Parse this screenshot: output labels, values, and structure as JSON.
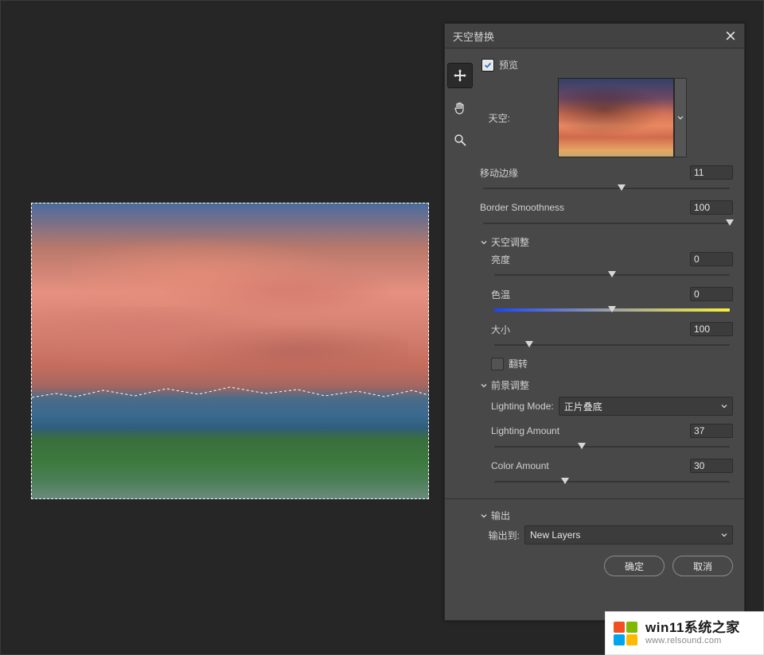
{
  "panel_title": "天空替换",
  "preview": {
    "label": "预览",
    "checked": true
  },
  "sky": {
    "label": "天空:"
  },
  "shift_edge": {
    "label": "移动边缘",
    "value": "11",
    "slider_pct": 56
  },
  "border_smoothness": {
    "label": "Border Smoothness",
    "value": "100",
    "slider_pct": 100
  },
  "sky_adjust_section": "天空调整",
  "brightness": {
    "label": "亮度",
    "value": "0",
    "slider_pct": 50
  },
  "temperature": {
    "label": "色温",
    "value": "0",
    "slider_pct": 50
  },
  "scale": {
    "label": "大小",
    "value": "100",
    "slider_pct": 15
  },
  "flip": {
    "label": "翻转",
    "checked": false
  },
  "foreground_section": "前景调整",
  "lighting_mode": {
    "label": "Lighting Mode:",
    "value": "正片叠底"
  },
  "lighting_amount": {
    "label": "Lighting Amount",
    "value": "37",
    "slider_pct": 37
  },
  "color_amount": {
    "label": "Color Amount",
    "value": "30",
    "slider_pct": 30
  },
  "output_section": "输出",
  "output_to": {
    "label": "输出到:",
    "value": "New Layers"
  },
  "buttons": {
    "ok": "确定",
    "cancel": "取消"
  },
  "watermark": {
    "title": "win11系统之家",
    "sub": "www.relsound.com"
  }
}
